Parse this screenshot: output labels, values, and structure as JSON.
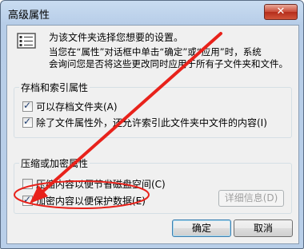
{
  "window": {
    "title": "高级属性",
    "close_glyph": "✕"
  },
  "intro": {
    "line1": "为该文件夹选择您想要的设置。",
    "line2": "当您在“属性”对话框中单击“确定”或“应用”时，系统",
    "line3": "会询问您是否将这些更改同时应用于所有子文件夹和文件。"
  },
  "archive_group": {
    "label": "存档和索引属性",
    "archive_checkbox": {
      "label": "可以存档文件夹(A)",
      "checked": true
    },
    "index_checkbox": {
      "label": "除了文件属性外，还允许索引此文件夹中文件的内容(I)",
      "checked": true
    }
  },
  "compress_group": {
    "label": "压缩或加密属性",
    "compress_checkbox": {
      "label": "压缩内容以便节省磁盘空间(C)",
      "checked": false
    },
    "encrypt_checkbox": {
      "label": "加密内容以便保护数据(E)",
      "checked": true
    },
    "details_button": "详细信息(D)"
  },
  "buttons": {
    "ok": "确定",
    "cancel": "取消"
  },
  "annotation": {
    "color": "#e8221b"
  }
}
